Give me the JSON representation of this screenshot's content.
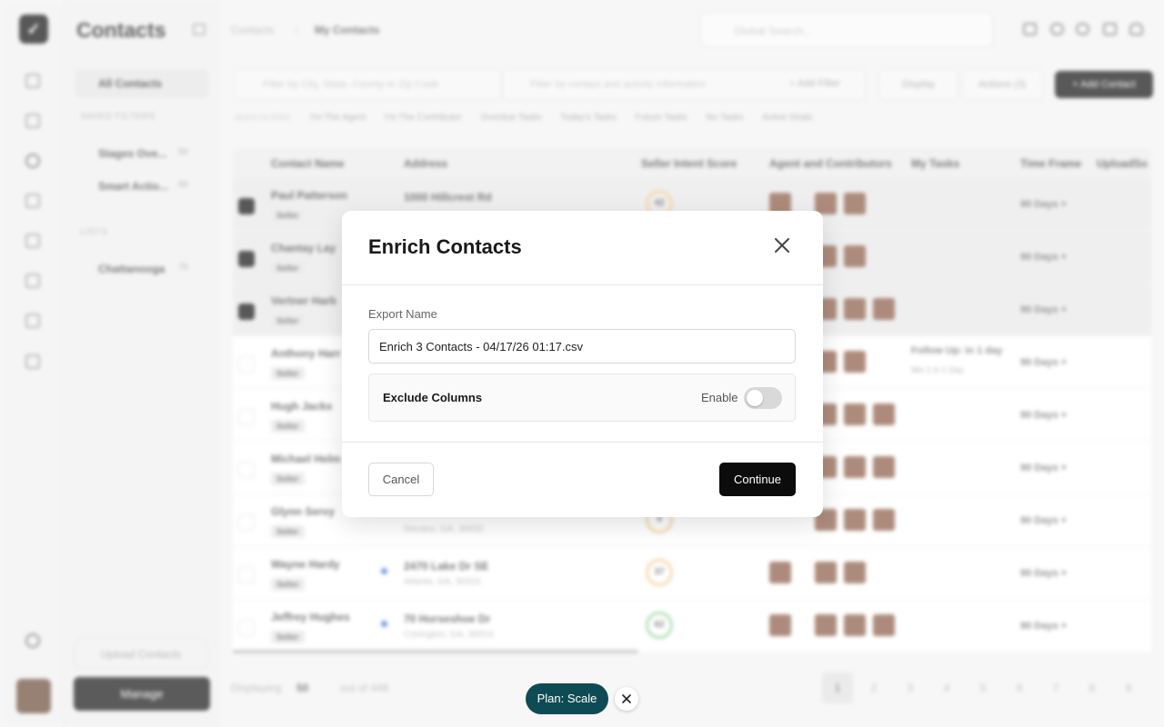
{
  "app": {
    "title": "Contacts",
    "breadcrumbs": [
      "Contacts",
      "My Contacts"
    ],
    "search_placeholder": "Global Search..."
  },
  "sidebar": {
    "all_contacts": "All Contacts",
    "saved_filters_heading": "SAVED FILTERS",
    "saved_filters": [
      {
        "label": "Stages Ove...",
        "count": "50"
      },
      {
        "label": "Smart Actio...",
        "count": "50"
      }
    ],
    "lists_heading": "LISTS",
    "lists": [
      {
        "label": "Chattanooga",
        "count": "76"
      }
    ],
    "upload_label": "Upload Contacts",
    "manage_label": "Manage"
  },
  "toolbar": {
    "location_placeholder": "Filter by City, State, County or Zip Code",
    "filter_placeholder": "Filter by contact and activity information",
    "add_filter": "+ Add Filter",
    "display": "Display",
    "actions": "Actions (3)",
    "add_contact": "+ Add Contact"
  },
  "quick_filters": {
    "label": "QUICK FILTERS:",
    "items": [
      "I'm The Agent",
      "I'm The Contributor",
      "Overdue Tasks",
      "Today's Tasks",
      "Future Tasks",
      "No Tasks",
      "Active Deals"
    ]
  },
  "table": {
    "headers": [
      "Contact Name",
      "Address",
      "Seller Intent Score",
      "Agent and Contributors",
      "My Tasks",
      "Time Frame",
      "UploadSo"
    ],
    "rows": [
      {
        "name": "Paul Patterson",
        "tag": "Seller",
        "address": "1000 Hillcrest Rd",
        "city": "",
        "score": "42",
        "time_frame": "90 Days +"
      },
      {
        "name": "Chantay Lay",
        "tag": "Seller",
        "address": "",
        "city": "",
        "score": "",
        "time_frame": "90 Days +"
      },
      {
        "name": "Vertner Harb",
        "tag": "Seller",
        "address": "",
        "city": "",
        "score": "",
        "time_frame": "90 Days +"
      },
      {
        "name": "Anthony Harr",
        "tag": "Seller",
        "address": "",
        "city": "",
        "score": "",
        "time_frame": "90 Days +",
        "task": "Follow Up: in 1 day",
        "task_sub": "Mix 1  In 1 Day"
      },
      {
        "name": "Hugh Jacks",
        "tag": "Seller",
        "address": "",
        "city": "",
        "score": "",
        "time_frame": "90 Days +"
      },
      {
        "name": "Michael Helm",
        "tag": "Seller",
        "address": "",
        "city": "",
        "score": "",
        "time_frame": "90 Days +"
      },
      {
        "name": "Glynn Servy",
        "tag": "Seller",
        "address": "",
        "city": "Decatur, GA, 30032",
        "score": "9",
        "time_frame": "90 Days +"
      },
      {
        "name": "Wayne Hardy",
        "tag": "Seller",
        "address": "2470 Lake Dr SE",
        "city": "Atlanta, GA, 30316",
        "score": "37",
        "time_frame": "90 Days +"
      },
      {
        "name": "Jeffrey Hughes",
        "tag": "Seller",
        "address": "70 Horseshoe Dr",
        "city": "Covington, GA, 30014",
        "score": "62",
        "time_frame": "90 Days +"
      }
    ]
  },
  "footer": {
    "displaying": "Displaying",
    "per_page": "50",
    "out_of": "out of 446",
    "pages": [
      "1",
      "2",
      "3",
      "4",
      "5",
      "6",
      "7",
      "8",
      "9"
    ]
  },
  "modal": {
    "title": "Enrich Contacts",
    "export_label": "Export Name",
    "export_value": "Enrich 3 Contacts - 04/17/26 01:17.csv",
    "exclude_label": "Exclude Columns",
    "enable_label": "Enable",
    "enable_on": false,
    "cancel": "Cancel",
    "continue": "Continue"
  },
  "plan_badge": "Plan: Scale"
}
